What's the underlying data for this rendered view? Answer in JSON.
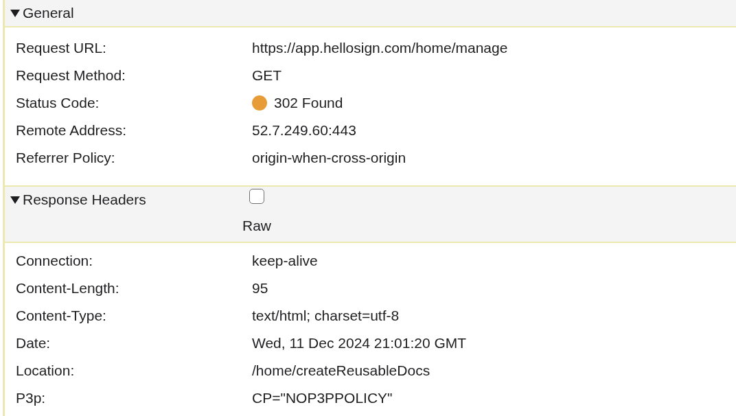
{
  "sections": [
    {
      "title": "General",
      "expanded": true,
      "rows": [
        {
          "name": "Request URL:",
          "value": "https://app.hellosign.com/home/manage"
        },
        {
          "name": "Request Method:",
          "value": "GET"
        },
        {
          "name": "Status Code:",
          "value": "302 Found",
          "color": "#e89c38"
        },
        {
          "name": "Remote Address:",
          "value": "52.7.249.60:443"
        },
        {
          "name": "Referrer Policy:",
          "value": "origin-when-cross-origin"
        }
      ]
    },
    {
      "title": "Response Headers",
      "expanded": true,
      "raw": {
        "label": "Raw",
        "checked": false
      },
      "rows": [
        {
          "name": "Connection:",
          "value": "keep-alive"
        },
        {
          "name": "Content-Length:",
          "value": "95"
        },
        {
          "name": "Content-Type:",
          "value": "text/html; charset=utf-8"
        },
        {
          "name": "Date:",
          "value": "Wed, 11 Dec 2024 21:01:20 GMT"
        },
        {
          "name": "Location:",
          "value": "/home/createReusableDocs"
        },
        {
          "name": "P3p:",
          "value": "CP=\"NOP3PPOLICY\""
        }
      ]
    }
  ]
}
